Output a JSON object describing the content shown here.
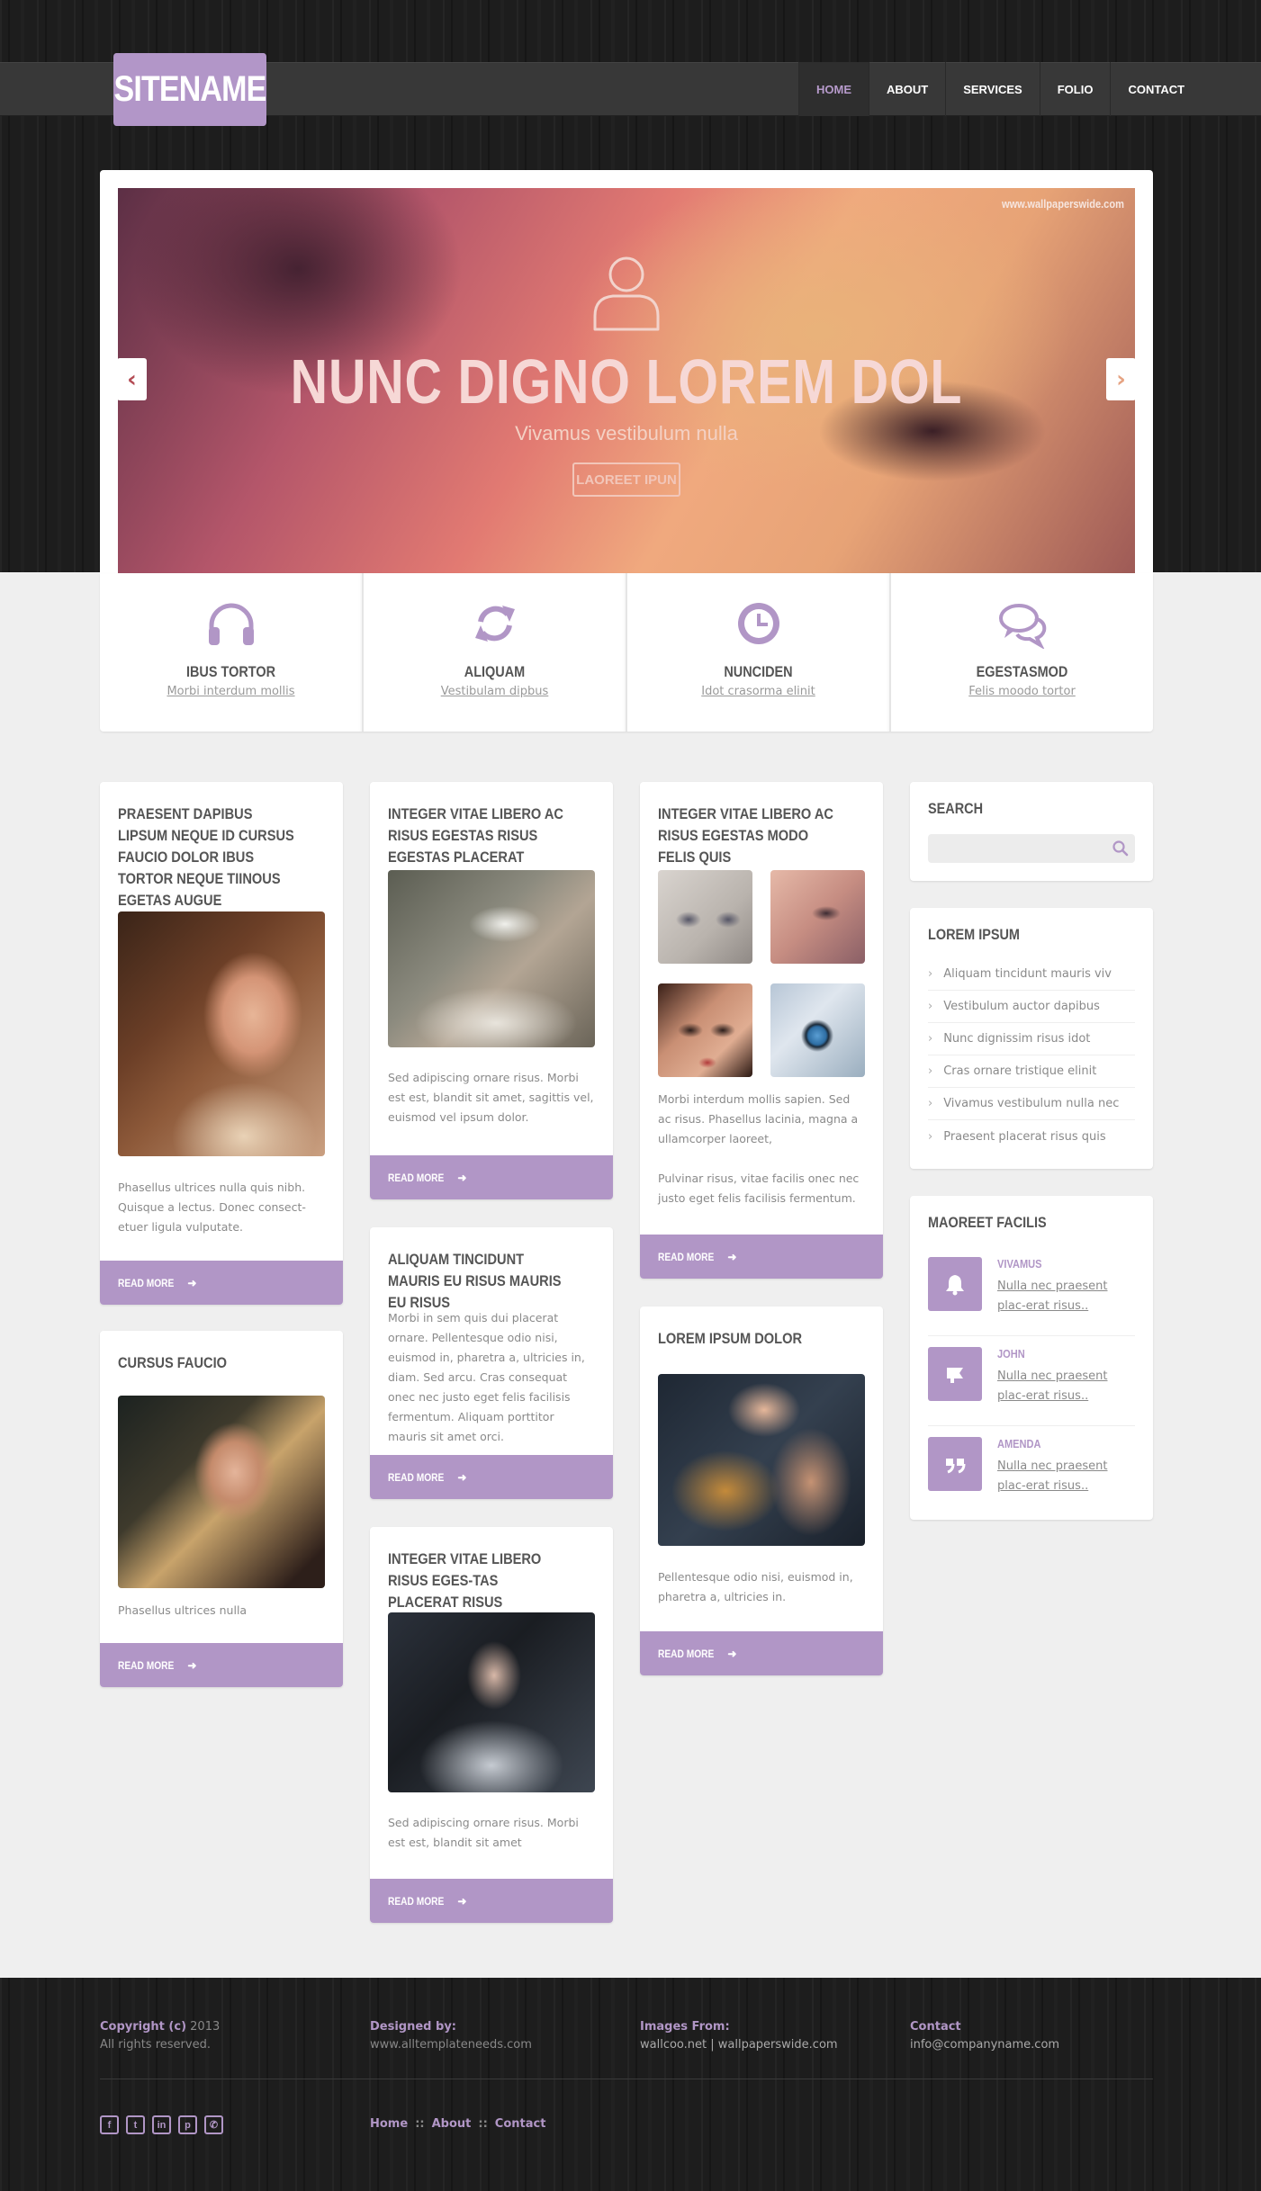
{
  "brand": {
    "name": "SITENAME",
    "accent": "#b196c6"
  },
  "nav": {
    "items": [
      {
        "label": "HOME",
        "active": true
      },
      {
        "label": "ABOUT"
      },
      {
        "label": "SERVICES"
      },
      {
        "label": "FOLIO"
      },
      {
        "label": "CONTACT"
      }
    ]
  },
  "slider": {
    "credit": "www.wallpaperswide.com",
    "heading": "NUNC DIGNO LOREM DOL",
    "subheading": "Vivamus vestibulum nulla",
    "button": "LAOREET IPUN",
    "icons": {
      "prev": "chevron-left-icon",
      "next": "chevron-right-icon",
      "person": "user-icon"
    }
  },
  "features": [
    {
      "icon": "headphones-icon",
      "title": "IBUS TORTOR",
      "link": "Morbi interdum mollis"
    },
    {
      "icon": "refresh-icon",
      "title": "ALIQUAM",
      "link": "Vestibulam dipbus"
    },
    {
      "icon": "clock-icon",
      "title": "NUNCIDEN",
      "link": "Idot crasorma elinit"
    },
    {
      "icon": "chat-icon",
      "title": "EGESTASMOD",
      "link": "Felis moodo tortor"
    }
  ],
  "posts": {
    "p1": {
      "title": "PRAESENT DAPIBUS LIPSUM NEQUE ID CURSUS FAUCIO DOLOR IBUS TORTOR NEQUE TIINOUS EGETAS AUGUE",
      "text": "Phasellus ultrices nulla quis nibh. Quisque a lectus. Donec consect-etuer ligula vulputate.",
      "more": "READ MORE"
    },
    "p2": {
      "title": "CURSUS FAUCIO",
      "text": "Phasellus ultrices nulla",
      "more": "READ MORE"
    },
    "p3": {
      "title": "INTEGER VITAE LIBERO AC RISUS EGESTAS RISUS EGESTAS PLACERAT",
      "text": "Sed adipiscing ornare risus. Morbi est est, blandit sit amet, sagittis vel, euismod vel ipsum dolor.",
      "more": "READ MORE"
    },
    "p4": {
      "title": "ALIQUAM TINCIDUNT MAURIS EU RISUS  MAURIS EU RISUS",
      "text": "Morbi in sem quis dui placerat ornare. Pellentesque odio nisi, euismod in, pharetra a, ultricies in, diam. Sed arcu. Cras consequat onec nec justo eget felis facilisis fermentum. Aliquam porttitor mauris sit amet orci.",
      "more": "READ MORE"
    },
    "p5": {
      "title": "INTEGER VITAE LIBERO RISUS EGES-TAS PLACERAT RISUS",
      "text": "Sed adipiscing ornare risus. Morbi est est, blandit sit amet",
      "more": "READ MORE"
    },
    "p6": {
      "title": "INTEGER VITAE LIBERO AC RISUS EGESTAS MODO FELIS QUIS",
      "text1": "Morbi interdum mollis sapien. Sed ac risus. Phasellus lacinia, magna a ullamcorper laoreet,",
      "text2": "Pulvinar risus, vitae facilis onec nec justo eget felis facilisis fermentum.",
      "more": "READ MORE"
    },
    "p7": {
      "title": "LOREM IPSUM DOLOR",
      "text": "Pellentesque odio nisi, euismod in, pharetra a, ultricies in.",
      "more": "READ MORE"
    }
  },
  "sidebar": {
    "search": {
      "title": "SEARCH",
      "placeholder": "",
      "icon": "search-icon"
    },
    "lorem": {
      "title": "LOREM IPSUM",
      "items": [
        "Aliquam tincidunt mauris viv",
        "Vestibulum auctor dapibus",
        "Nunc dignissim risus idot",
        "Cras ornare tristique elinit",
        "Vivamus vestibulum nulla nec",
        "Praesent placerat risus quis"
      ]
    },
    "testimonials": {
      "title": "MAOREET FACILIS",
      "items": [
        {
          "icon": "bell-icon",
          "name": "VIVAMUS",
          "text": "Nulla nec praesent plac-erat risus.."
        },
        {
          "icon": "flag-icon",
          "name": "JOHN",
          "text": "Nulla nec praesent plac-erat risus.."
        },
        {
          "icon": "quote-icon",
          "name": "AMENDA",
          "text": "Nulla nec praesent plac-erat risus.."
        }
      ]
    }
  },
  "footer": {
    "copyright": {
      "heading": "Copyright (c)",
      "year": "2013",
      "sub": "All rights reserved."
    },
    "designed": {
      "heading": "Designed by:",
      "value": "www.alltemplateneeds.com"
    },
    "images": {
      "heading": "Images From:",
      "value": "wallcoo.net | wallpaperswide.com"
    },
    "contact": {
      "heading": "Contact",
      "value": "info@companyname.com"
    },
    "social": [
      {
        "icon": "facebook-icon",
        "glyph": "f"
      },
      {
        "icon": "twitter-icon",
        "glyph": "t"
      },
      {
        "icon": "linkedin-icon",
        "glyph": "in"
      },
      {
        "icon": "pinterest-icon",
        "glyph": "p"
      },
      {
        "icon": "phone-icon",
        "glyph": "✆"
      }
    ],
    "links": {
      "home": "Home",
      "about": "About",
      "contact": "Contact",
      "sep": "::"
    }
  }
}
